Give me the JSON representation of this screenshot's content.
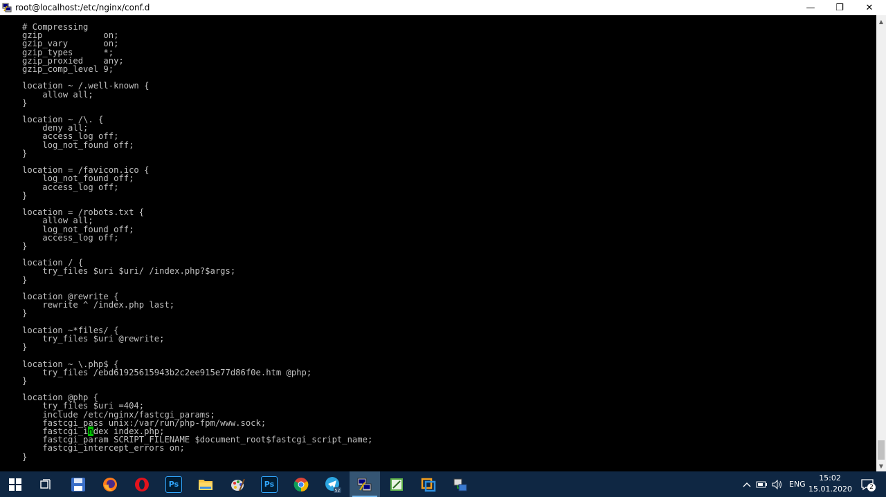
{
  "window": {
    "title": "root@localhost:/etc/nginx/conf.d",
    "minimize_glyph": "—",
    "maximize_glyph": "❐",
    "close_glyph": "✕"
  },
  "terminal": {
    "lines": [
      "# Compressing",
      "gzip            on;",
      "gzip_vary       on;",
      "gzip_types      *;",
      "gzip_proxied    any;",
      "gzip_comp_level 9;",
      "",
      "location ~ /.well-known {",
      "    allow all;",
      "}",
      "",
      "location ~ /\\. {",
      "    deny all;",
      "    access_log off;",
      "    log_not_found off;",
      "}",
      "",
      "location = /favicon.ico {",
      "    log_not_found off;",
      "    access_log off;",
      "}",
      "",
      "location = /robots.txt {",
      "    allow all;",
      "    log_not_found off;",
      "    access_log off;",
      "}",
      "",
      "location / {",
      "    try_files $uri $uri/ /index.php?$args;",
      "}",
      "",
      "location @rewrite {",
      "    rewrite ^ /index.php last;",
      "}",
      "",
      "location ~*files/ {",
      "    try_files $uri @rewrite;",
      "}",
      "",
      "location ~ \\.php$ {",
      "    try_files /ebd61925615943b2c2ee915e77d86f0e.htm @php;",
      "}",
      "",
      "location @php {",
      "    try_files $uri =404;",
      "    include /etc/nginx/fastcgi_params;",
      "    fastcgi_pass unix:/var/run/php-fpm/www.sock;",
      "    fastcgi_index index.php;",
      "    fastcgi_param SCRIPT_FILENAME $document_root$fastcgi_script_name;",
      "    fastcgi_intercept_errors on;",
      "}"
    ],
    "cursor_line": 48,
    "cursor_col": 13,
    "text_color": "#c0c0c0",
    "cursor_color": "#00c000",
    "background": "#000000"
  },
  "taskbar": {
    "background": "#0f2743",
    "items": [
      {
        "name": "start-button",
        "icon": "windows-logo-icon",
        "active": false
      },
      {
        "name": "task-view-button",
        "icon": "task-view-icon",
        "active": false
      },
      {
        "name": "taskbar-app-save",
        "icon": "floppy-disk-icon",
        "active": false
      },
      {
        "name": "taskbar-app-firefox",
        "icon": "firefox-icon",
        "active": false
      },
      {
        "name": "taskbar-app-opera",
        "icon": "opera-icon",
        "active": false
      },
      {
        "name": "taskbar-app-photoshop",
        "icon": "photoshop-icon",
        "label": "Ps",
        "active": false
      },
      {
        "name": "taskbar-app-explorer",
        "icon": "folder-icon",
        "active": false
      },
      {
        "name": "taskbar-app-paint",
        "icon": "paint-palette-icon",
        "active": false
      },
      {
        "name": "taskbar-app-photoshop-2",
        "icon": "photoshop-icon",
        "label": "Ps",
        "active": false
      },
      {
        "name": "taskbar-app-chrome",
        "icon": "chrome-icon",
        "active": false
      },
      {
        "name": "taskbar-app-telegram",
        "icon": "telegram-icon",
        "badge": "52",
        "active": false
      },
      {
        "name": "taskbar-app-putty",
        "icon": "putty-icon",
        "active": true
      },
      {
        "name": "taskbar-app-notepad",
        "icon": "notepad-icon",
        "active": false
      },
      {
        "name": "taskbar-app-virtualbox",
        "icon": "virtualbox-icon",
        "active": false
      },
      {
        "name": "taskbar-app-network",
        "icon": "network-tool-icon",
        "active": false
      }
    ],
    "tray": {
      "language": "ENG",
      "time": "15:02",
      "date": "15.01.2020",
      "notification_count": "2"
    }
  }
}
